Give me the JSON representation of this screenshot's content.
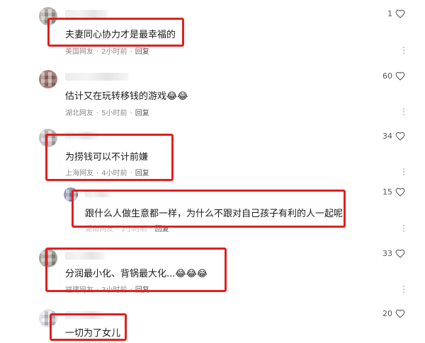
{
  "comments": [
    {
      "text": "夫妻同心协力才是最幸福的",
      "location": "美国网友",
      "time": "2小时前",
      "reply_label": "回复",
      "likes": "1"
    },
    {
      "text": "估计又在玩转移钱的游戏",
      "emojis": "😂😂",
      "location": "湖北网友",
      "time": "5小时前",
      "reply_label": "回复",
      "likes": "60"
    },
    {
      "text": "为捞钱可以不计前嫌",
      "location": "上海网友",
      "time": "4小时前",
      "reply_label": "回复",
      "likes": "34"
    },
    {
      "text": "跟什么人做生意都一样，为什么不跟对自己孩子有利的人一起呢",
      "location": "湖南网友",
      "time": "2小时前",
      "reply_label": "回复",
      "likes": "15"
    },
    {
      "text": "分润最小化、背锅最大化...",
      "emojis": "😂😂😂",
      "location": "福建网友",
      "time": "3小时前",
      "reply_label": "回复",
      "likes": "33"
    },
    {
      "text": "一切为了女儿",
      "likes": "20"
    }
  ],
  "colors": {
    "highlight": "#e02020",
    "meta": "#8a8a8a"
  }
}
